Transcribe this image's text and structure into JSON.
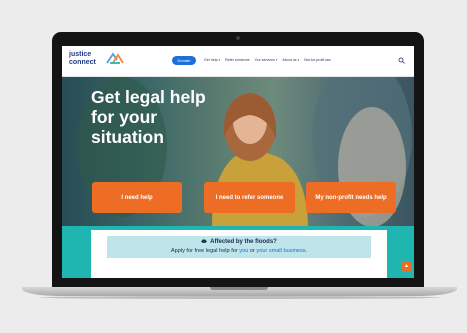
{
  "header": {
    "logo_text": "justice\nconnect",
    "donate_label": "Donate",
    "nav": [
      {
        "label": "Get help"
      },
      {
        "label": "Refer someone"
      },
      {
        "label": "Our services"
      },
      {
        "label": "About us"
      },
      {
        "label": "Not-for-profit law"
      }
    ]
  },
  "hero": {
    "title_lines": [
      "Get legal help",
      "for your",
      "situation"
    ],
    "cta": [
      {
        "label": "I need help"
      },
      {
        "label": "I need to refer someone"
      },
      {
        "label": "My non-profit needs help"
      }
    ]
  },
  "notice": {
    "heading": "Affected by the floods?",
    "prefix": "Apply for free legal help for ",
    "link1": "you",
    "middle": " or ",
    "link2": "your small business",
    "suffix": "."
  },
  "colors": {
    "accent_orange": "#ed6d25",
    "brand_blue": "#1d6fd8",
    "teal": "#1fb5b0",
    "notice_bg": "#bde5ea"
  },
  "icons": [
    "logo-mark-icon",
    "search-icon",
    "chevron-down-icon",
    "cloud-icon",
    "arrow-up-icon"
  ]
}
